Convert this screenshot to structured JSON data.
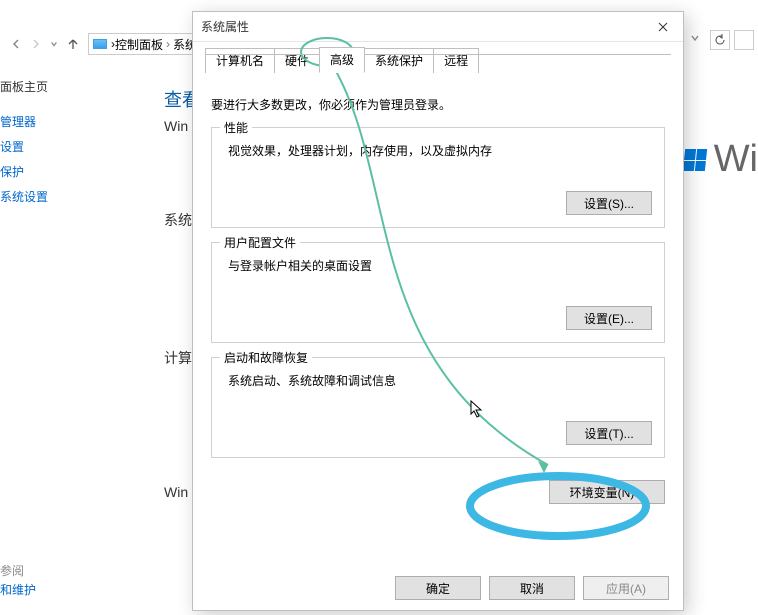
{
  "breadcrumb": {
    "item1": "控制面板",
    "item2": "系统",
    "sep1": "›",
    "sep2": "›",
    "sep3": "›"
  },
  "sidebar": {
    "heading": "面板主页",
    "links": [
      "管理器",
      "设置",
      "保护",
      "系统设置"
    ],
    "bottom_heading": "参阅",
    "bottom_link": "和维护"
  },
  "behind": {
    "t1": "查看",
    "t2": "Win",
    "t3": "系统",
    "t4": "计算",
    "t5": "Win",
    "cursor": "⬚"
  },
  "winlogo_text": "Wi",
  "dialog": {
    "title": "系统属性",
    "tabs": [
      "计算机名",
      "硬件",
      "高级",
      "系统保护",
      "远程"
    ],
    "active_tab_index": 2,
    "intro": "要进行大多数更改，你必须作为管理员登录。",
    "groups": [
      {
        "title": "性能",
        "desc": "视觉效果，处理器计划，内存使用，以及虚拟内存",
        "button": "设置(S)..."
      },
      {
        "title": "用户配置文件",
        "desc": "与登录帐户相关的桌面设置",
        "button": "设置(E)..."
      },
      {
        "title": "启动和故障恢复",
        "desc": "系统启动、系统故障和调试信息",
        "button": "设置(T)..."
      }
    ],
    "env_button": "环境变量(N)...",
    "ok": "确定",
    "cancel": "取消",
    "apply": "应用(A)"
  }
}
